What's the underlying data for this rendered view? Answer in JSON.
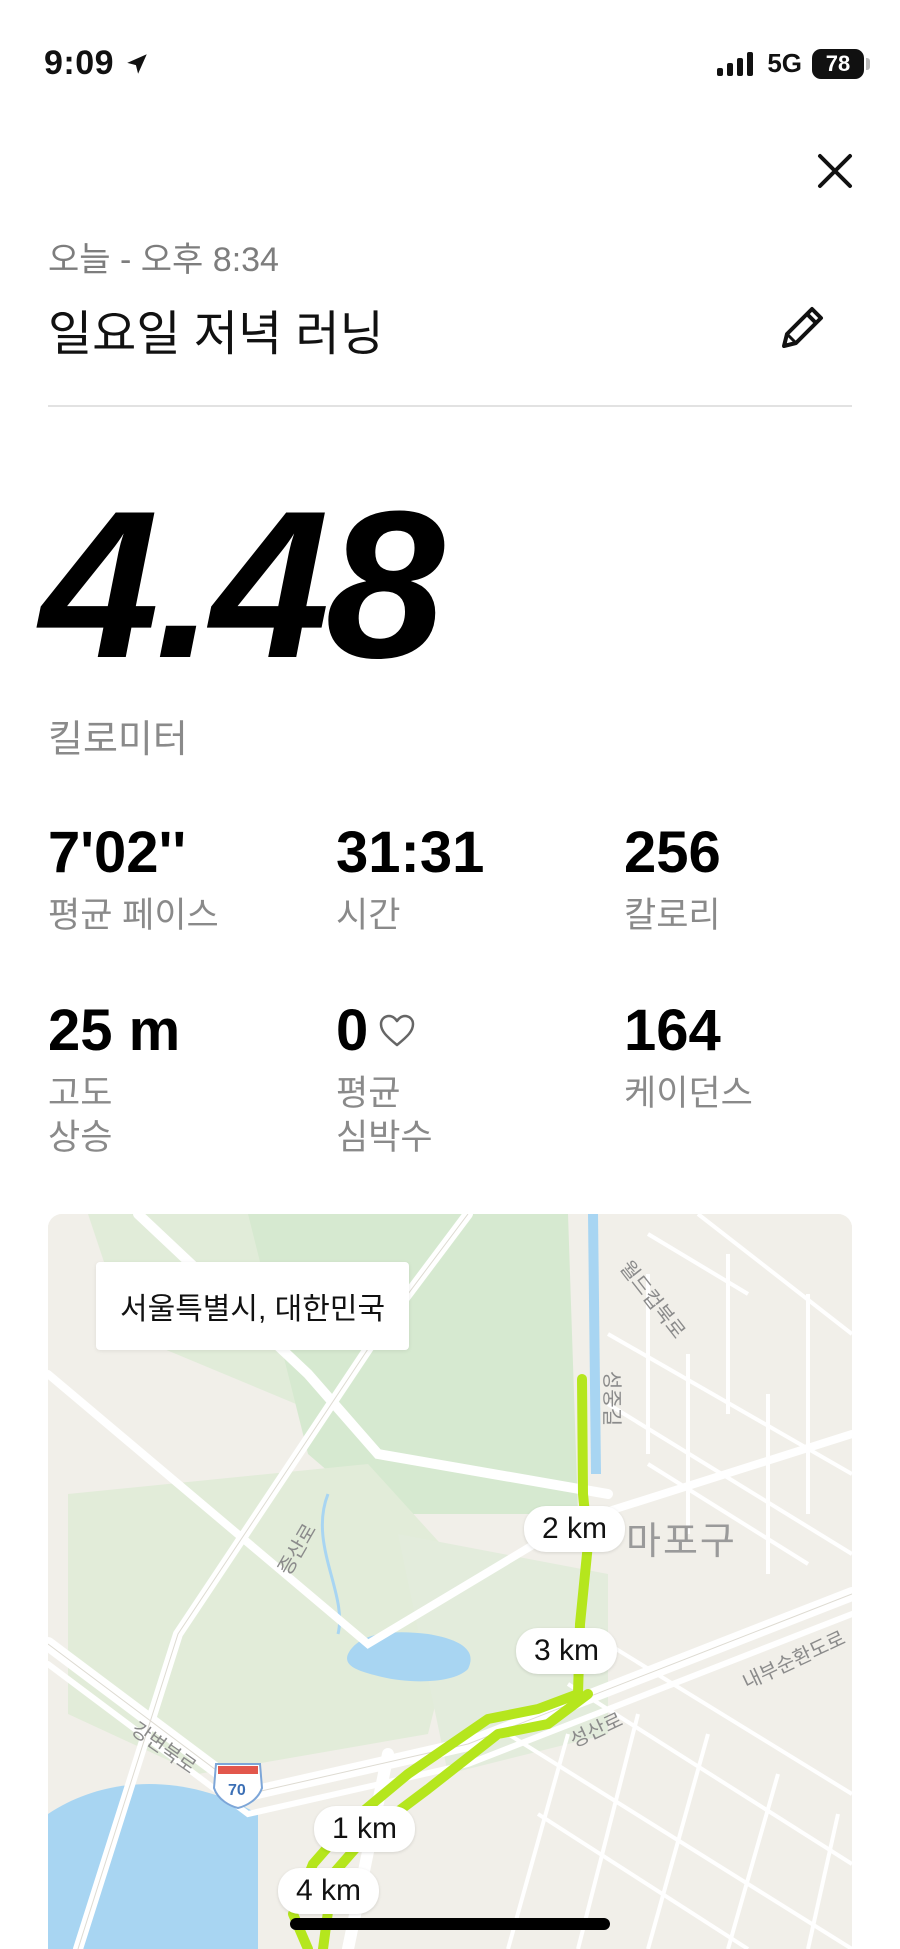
{
  "status_bar": {
    "time": "9:09",
    "network": "5G",
    "battery": "78"
  },
  "header": {
    "date": "오늘 - 오후 8:34",
    "title": "일요일 저녁 러닝"
  },
  "distance": {
    "value": "4.48",
    "unit": "킬로미터"
  },
  "stats": [
    {
      "value": "7'02''",
      "label": "평균 페이스"
    },
    {
      "value": "31:31",
      "label": "시간"
    },
    {
      "value": "256",
      "label": "칼로리"
    },
    {
      "value": "25 m",
      "label": "고도\n상승"
    },
    {
      "value": "0",
      "label": "평균\n심박수"
    },
    {
      "value": "164",
      "label": "케이던스"
    }
  ],
  "map": {
    "location": "서울특별시, 대한민국",
    "district": "마포구",
    "markers": [
      "1 km",
      "2 km",
      "3 km",
      "4 km"
    ],
    "roads": {
      "worldcup": "월드컵북로",
      "seongjung": "성중길",
      "jeungsan": "증산로",
      "naebu": "내부순환도로",
      "seongsan": "성산로",
      "gangbyeon": "강변북로",
      "highway_num": "70"
    }
  },
  "colors": {
    "route": "#b5e61d",
    "water": "#a8d5f2",
    "park": "#d9ecd3",
    "muted_text": "#8a8a8a"
  }
}
